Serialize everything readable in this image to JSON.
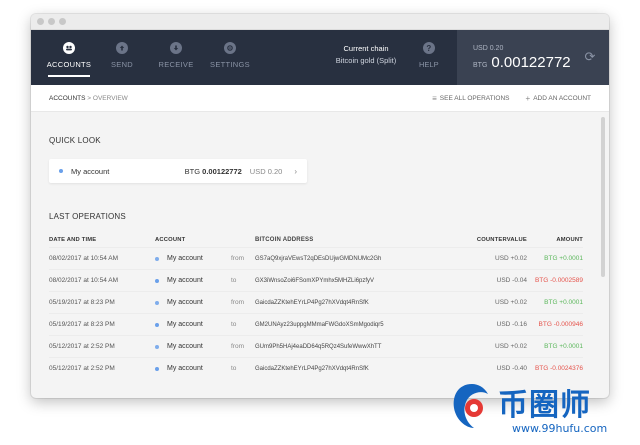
{
  "nav": {
    "items": [
      {
        "label": "ACCOUNTS",
        "icon": "accounts-icon",
        "active": true
      },
      {
        "label": "SEND",
        "icon": "send-icon",
        "active": false
      },
      {
        "label": "RECEIVE",
        "icon": "receive-icon",
        "active": false
      },
      {
        "label": "SETTINGS",
        "icon": "settings-icon",
        "active": false
      }
    ],
    "chain_label": "Current chain",
    "chain_value": "Bitcoin gold (Split)",
    "help_label": "HELP"
  },
  "balance": {
    "fiat": "USD 0.20",
    "unit": "BTG",
    "value": "0.00122772"
  },
  "breadcrumb": {
    "root": "ACCOUNTS",
    "separator": ">",
    "current": "OVERVIEW"
  },
  "actions": {
    "see_all": "SEE ALL OPERATIONS",
    "add_account": "ADD AN ACCOUNT"
  },
  "quick_look": {
    "title": "QUICK LOOK",
    "account_name": "My account",
    "balance_unit": "BTG",
    "balance_value": "0.00122772",
    "fiat": "USD 0.20",
    "chevron": "›"
  },
  "last_operations": {
    "title": "LAST OPERATIONS",
    "columns": {
      "date": "DATE AND TIME",
      "account": "ACCOUNT",
      "address": "BITCOIN ADDRESS",
      "countervalue": "COUNTERVALUE",
      "amount": "AMOUNT"
    },
    "rows": [
      {
        "date": "08/02/2017 at 10:54 AM",
        "account": "My account",
        "dir": "from",
        "address": "GS7aQ9xjraVEwsT2qDEsDUjwGMDNUMc2Gh",
        "countervalue": "USD +0.02",
        "amount": "BTG +0.0001",
        "positive": true
      },
      {
        "date": "08/02/2017 at 10:54 AM",
        "account": "My account",
        "dir": "to",
        "address": "GX3iWnsoZoi6FSomXPYmhx5MHZLi6pzfyV",
        "countervalue": "USD -0.04",
        "amount": "BTG -0.0002589",
        "positive": false
      },
      {
        "date": "05/19/2017 at 8:23 PM",
        "account": "My account",
        "dir": "from",
        "address": "GaicdaZZKtehEYrLP4Pg27hXVdqt4RnSfK",
        "countervalue": "USD +0.02",
        "amount": "BTG +0.0001",
        "positive": true
      },
      {
        "date": "05/19/2017 at 8:23 PM",
        "account": "My account",
        "dir": "to",
        "address": "GM2UNAyz23uppgMMmaFWGdoXSmMgodiqr5",
        "countervalue": "USD -0.16",
        "amount": "BTG -0.000946",
        "positive": false
      },
      {
        "date": "05/12/2017 at 2:52 PM",
        "account": "My account",
        "dir": "from",
        "address": "GUm9Ph5HAj4eaDD64q5RQz4SufeWwwXhTT",
        "countervalue": "USD +0.02",
        "amount": "BTG +0.0001",
        "positive": true
      },
      {
        "date": "05/12/2017 at 2:52 PM",
        "account": "My account",
        "dir": "to",
        "address": "GaicdaZZKtehEYrLP4Pg27hXVdqt4RnSfK",
        "countervalue": "USD -0.40",
        "amount": "BTG -0.0024376",
        "positive": false
      }
    ]
  },
  "colors": {
    "topbar": "#283040",
    "balance_bg": "#3a4252",
    "positive": "#5bb75b",
    "negative": "#e5534b",
    "account_bullet": "#6aa0ea"
  },
  "watermark": {
    "text": "币圈师",
    "url": "www.99hufu.com"
  }
}
